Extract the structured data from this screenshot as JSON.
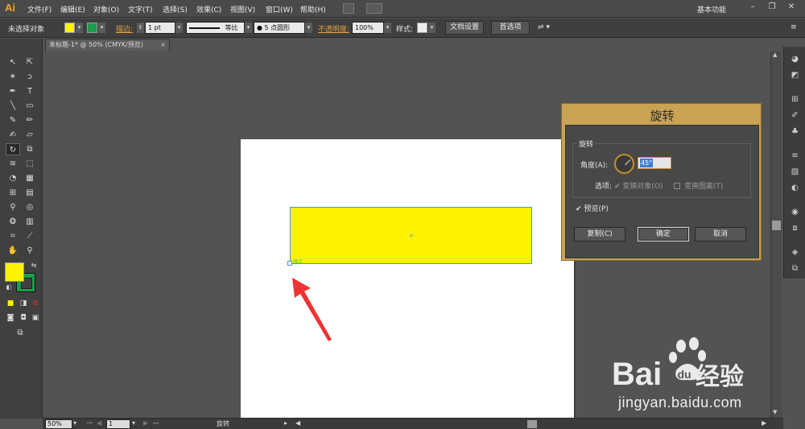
{
  "app": {
    "logo": "Ai"
  },
  "menu": [
    "文件(F)",
    "编辑(E)",
    "对象(O)",
    "文字(T)",
    "选择(S)",
    "效果(C)",
    "视图(V)",
    "窗口(W)",
    "帮助(H)"
  ],
  "workspace": "基本功能",
  "window_controls": [
    "–",
    "❐",
    "✕"
  ],
  "control_bar": {
    "selection_status": "未选择对象",
    "fill_color": "#fff200",
    "stroke_color": "#1b9e4b",
    "stroke_label": "描边:",
    "stroke_weight": "1 pt",
    "profile": "等比",
    "brush": "5 点圆形",
    "opacity_label": "不透明度:",
    "opacity_value": "100%",
    "style_label": "样式:",
    "doc_setup_button": "文档设置",
    "preferences_button": "首选项"
  },
  "document_tab": {
    "title": "未标题-1* @ 50% (CMYK/预览)",
    "close": "×"
  },
  "status_bar": {
    "zoom": "50%",
    "page": "1",
    "tool_name": "旋转"
  },
  "canvas": {
    "anchor_label": "锚点",
    "center_marker": "×"
  },
  "rotate_dialog": {
    "title": "旋转",
    "group_title": "旋转",
    "angle_label": "角度(A):",
    "angle_value": "45°",
    "options_label": "选项:",
    "transform_objects": "变换对象(O)",
    "transform_objects_checked": true,
    "transform_patterns": "变换图案(T)",
    "transform_patterns_checked": false,
    "preview": "预览(P)",
    "preview_checked": true,
    "copy_button": "复制(C)",
    "ok_button": "确定",
    "cancel_button": "取消"
  },
  "watermark": {
    "brand": "Baidu经验",
    "url": "jingyan.baidu.com"
  },
  "colors": {
    "accent": "#c9a253",
    "selection": "#4a90d9",
    "arrow": "#ee3333"
  }
}
